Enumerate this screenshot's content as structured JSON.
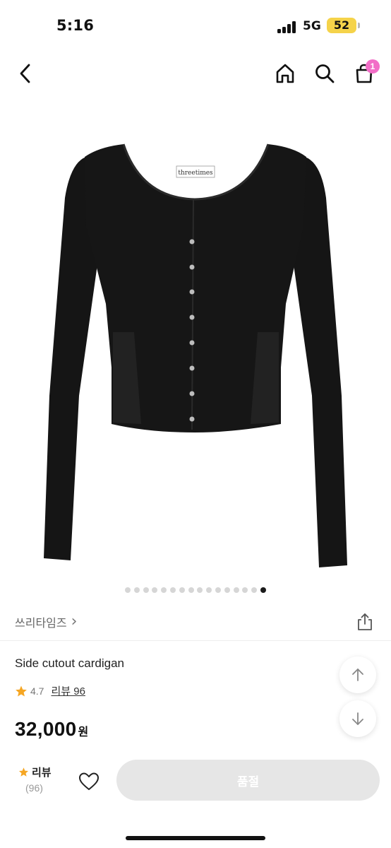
{
  "status_bar": {
    "time": "5:16",
    "network": "5G",
    "battery": "52"
  },
  "nav": {
    "back_icon": "chevron-left-icon",
    "home_icon": "home-icon",
    "search_icon": "search-icon",
    "cart_icon": "shopping-bag-icon",
    "cart_count": "1"
  },
  "product_image": {
    "label_text": "threetimes",
    "slide_count": 16,
    "active_slide": 16
  },
  "brand": {
    "name": "쓰리타임즈",
    "chevron": "›"
  },
  "product": {
    "name": "Side cutout cardigan",
    "rating": "4.7",
    "review_link": "리뷰 96",
    "price": "32,000",
    "currency": "원"
  },
  "bottom_bar": {
    "review_label": "리뷰",
    "review_count": "(96)",
    "soldout_label": "품절"
  },
  "colors": {
    "accent_pink": "#f26ec7",
    "star": "#f5a623",
    "disabled_button": "#e6e6e6"
  }
}
